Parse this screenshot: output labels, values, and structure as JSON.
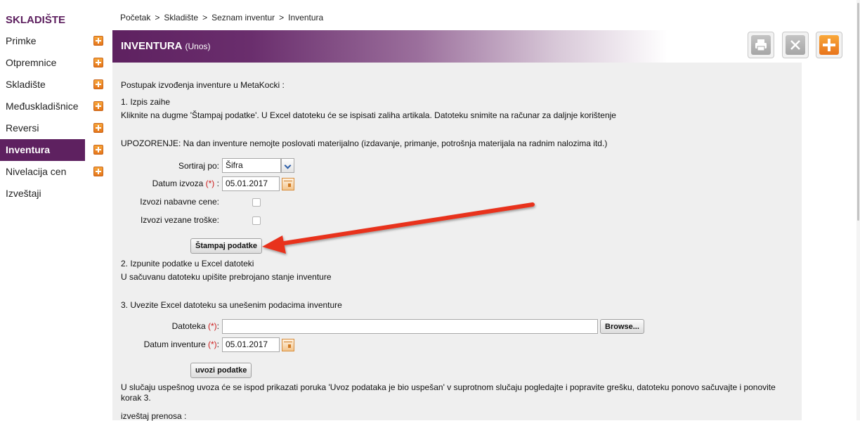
{
  "sidebar": {
    "title": "SKLADIŠTE",
    "items": [
      {
        "label": "Primke",
        "has_add": true
      },
      {
        "label": "Otpremnice",
        "has_add": true
      },
      {
        "label": "Skladište",
        "has_add": true
      },
      {
        "label": "Međuskladišnice",
        "has_add": true
      },
      {
        "label": "Reversi",
        "has_add": true
      },
      {
        "label": "Inventura",
        "has_add": true,
        "active": true
      },
      {
        "label": "Nivelacija cen",
        "has_add": true
      },
      {
        "label": "Izveštaji",
        "has_add": false
      }
    ]
  },
  "breadcrumb": [
    "Početak",
    "Skladište",
    "Seznam inventur",
    "Inventura"
  ],
  "breadcrumb_sep": ">",
  "header": {
    "title": "INVENTURA",
    "subtitle": "(Unos)"
  },
  "toolbar": {
    "icons": [
      "print-icon",
      "close-icon",
      "add-icon"
    ]
  },
  "content": {
    "intro": "Postupak izvođenja inventure u MetaKocki :",
    "step1_title": "1. Izpis zaihe",
    "step1_text": "Kliknite na dugme 'Štampaj podatke'. U Excel datoteku će se ispisati zaliha artikala. Datoteku snimite na računar za daljnje korištenje",
    "warning": "UPOZORENJE: Na dan inventure nemojte poslovati materijalno (izdavanje, primanje, potrošnja materijala na radnim nalozima itd.)",
    "sort_label": "Sortiraj po:",
    "sort_value": "Šifra",
    "export_date_label": "Datum izvoza",
    "required_mark": "(*)",
    "colon": ":",
    "export_date_value": "05.01.2017",
    "export_purchase_label": "Izvozi nabavne cene:",
    "export_costs_label": "Izvozi vezane troške:",
    "print_button": "Štampaj podatke",
    "step2_title": "2. Izpunite podatke u Excel datoteki",
    "step2_text": "U sačuvanu datoteku upišite prebrojano stanje inventure",
    "step3_title": "3. Uvezite Excel datoteku sa unešenim podacima inventure",
    "file_label": "Datoteka",
    "file_value": "",
    "browse_button": "Browse...",
    "inv_date_label": "Datum inventure",
    "inv_date_value": "05.01.2017",
    "import_button": "uvozi podatke",
    "import_note_line1": "U slučaju uspešnog uvoza će se ispod prikazati poruka 'Uvoz podataka je bio uspešan' v suprotnom slučaju pogledajte i popravite grešku, datoteku ponovo sačuvajte i ponovite",
    "import_note_line2": "korak 3.",
    "report_label": "izveštaj prenosa :"
  },
  "colors": {
    "brand": "#5e2160",
    "accent_orange": "#e8731b",
    "annotation_arrow": "#e8321f",
    "required": "#cc1b1b"
  }
}
